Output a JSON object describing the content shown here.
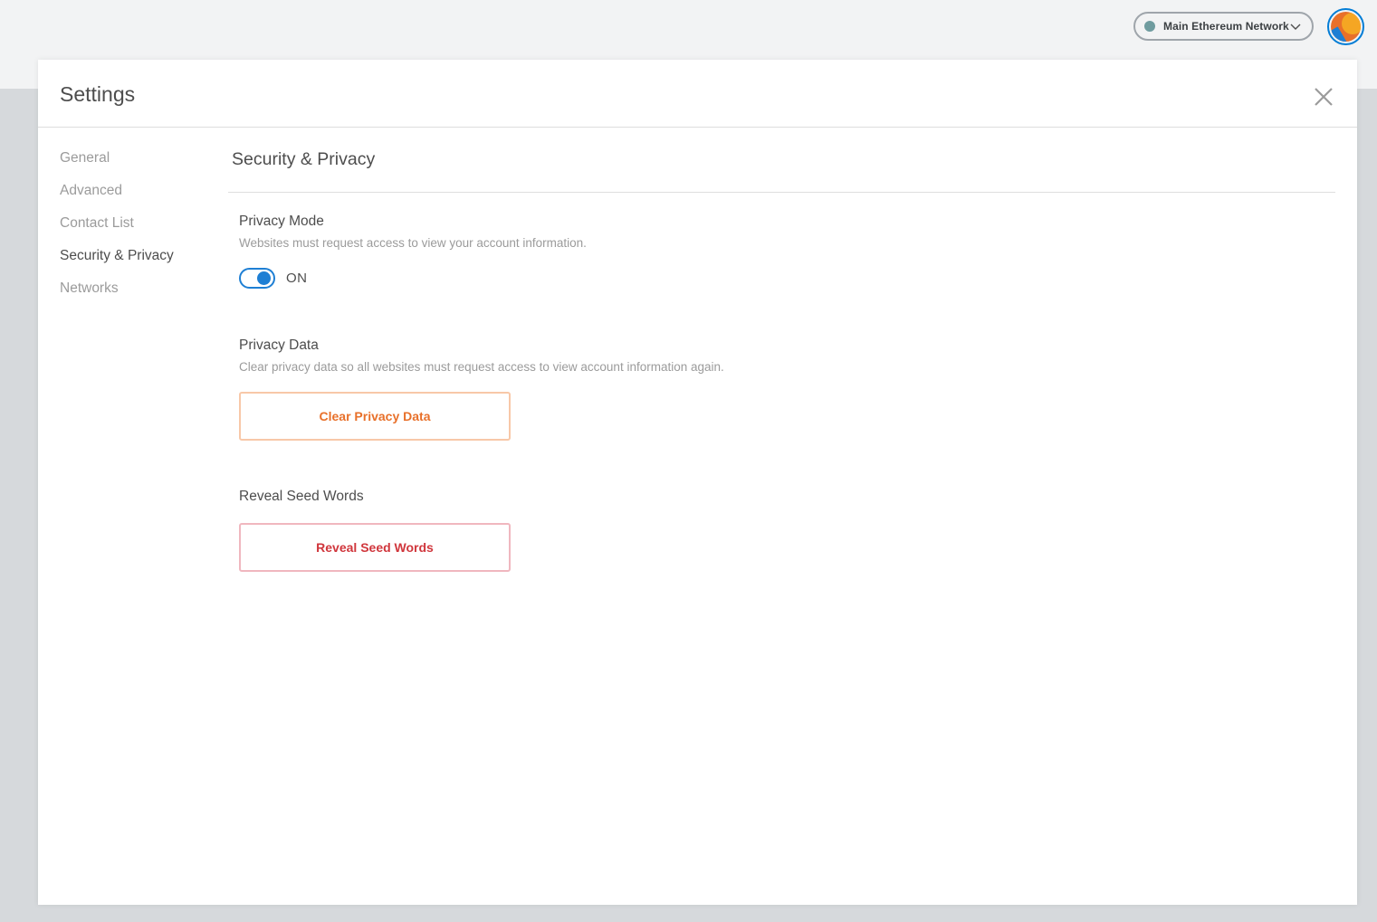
{
  "header": {
    "network": {
      "label": "Main Ethereum Network",
      "dot_color": "#6f9c9f",
      "icon": "chevron-down-icon"
    },
    "avatar": {
      "icon": "account-identicon",
      "colors": [
        "#e8702a",
        "#f58a1f",
        "#1e7fd4"
      ]
    }
  },
  "settings": {
    "title": "Settings",
    "close_icon": "close-icon",
    "sidebar": {
      "items": [
        {
          "label": "General",
          "active": false
        },
        {
          "label": "Advanced",
          "active": false
        },
        {
          "label": "Contact List",
          "active": false
        },
        {
          "label": "Security & Privacy",
          "active": true
        },
        {
          "label": "Networks",
          "active": false
        }
      ]
    },
    "section": {
      "title": "Security & Privacy",
      "privacy_mode": {
        "label": "Privacy Mode",
        "description": "Websites must request access to view your account information.",
        "toggle_state": "ON",
        "toggle_color": "#1e7fd4"
      },
      "privacy_data": {
        "label": "Privacy Data",
        "description": "Clear privacy data so all websites must request access to view account information again.",
        "button_label": "Clear Privacy Data",
        "button_color": "#e8702a"
      },
      "seed_words": {
        "label": "Reveal Seed Words",
        "button_label": "Reveal Seed Words",
        "button_color": "#d0363c"
      }
    }
  }
}
